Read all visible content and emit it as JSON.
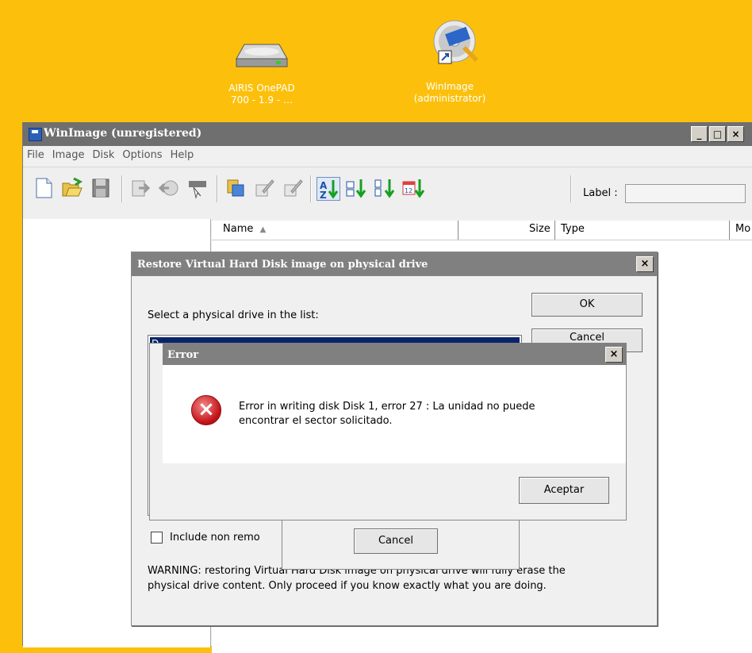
{
  "desktop": {
    "icons": [
      {
        "name": "drive-icon",
        "label_line1": "AIRIS OnePAD",
        "label_line2": "700 - 1.9 - …"
      },
      {
        "name": "winimage-app-icon",
        "label_line1": "WinImage",
        "label_line2": "(administrator)"
      }
    ]
  },
  "main_window": {
    "title": "WinImage (unregistered)",
    "buttons": {
      "minimize": "_",
      "maximize": "□",
      "close": "×"
    },
    "menu": [
      "File",
      "Image",
      "Disk",
      "Options",
      "Help"
    ],
    "toolbar": {
      "icons": [
        "new-icon",
        "open-icon",
        "save-icon",
        "inject-icon",
        "extract-icon",
        "disk-write-icon",
        "properties-icon",
        "edit-icon",
        "edit2-icon",
        "sort-name-icon",
        "sort-ext-icon",
        "sort-size-icon",
        "sort-date-icon"
      ],
      "label_text": "Label :",
      "label_value": ""
    },
    "columns": [
      "Name",
      "Size",
      "Type",
      "Mo"
    ],
    "sort_indicator": "▲"
  },
  "restore_dialog": {
    "title": "Restore Virtual Hard Disk image on physical drive",
    "close": "×",
    "select_label": "Select a physical drive in the list:",
    "selected_item": "D",
    "ok_label": "OK",
    "cancel_label": "Cancel",
    "checkbox_label": "Include non remo",
    "warning_line1": "WARNING: restoring Virtual Hard Disk image on physical drive will fully erase the",
    "warning_line2": "physical drive content. Only proceed if you know exactly what you are doing."
  },
  "progress_dialog": {
    "cancel_label": "Cancel"
  },
  "error_dialog": {
    "title": "Error",
    "close": "×",
    "icon": "error-icon",
    "message_line1": "Error in writing disk Disk 1, error 27 : La unidad no puede",
    "message_line2": "encontrar el sector solicitado.",
    "button_label": "Aceptar"
  }
}
